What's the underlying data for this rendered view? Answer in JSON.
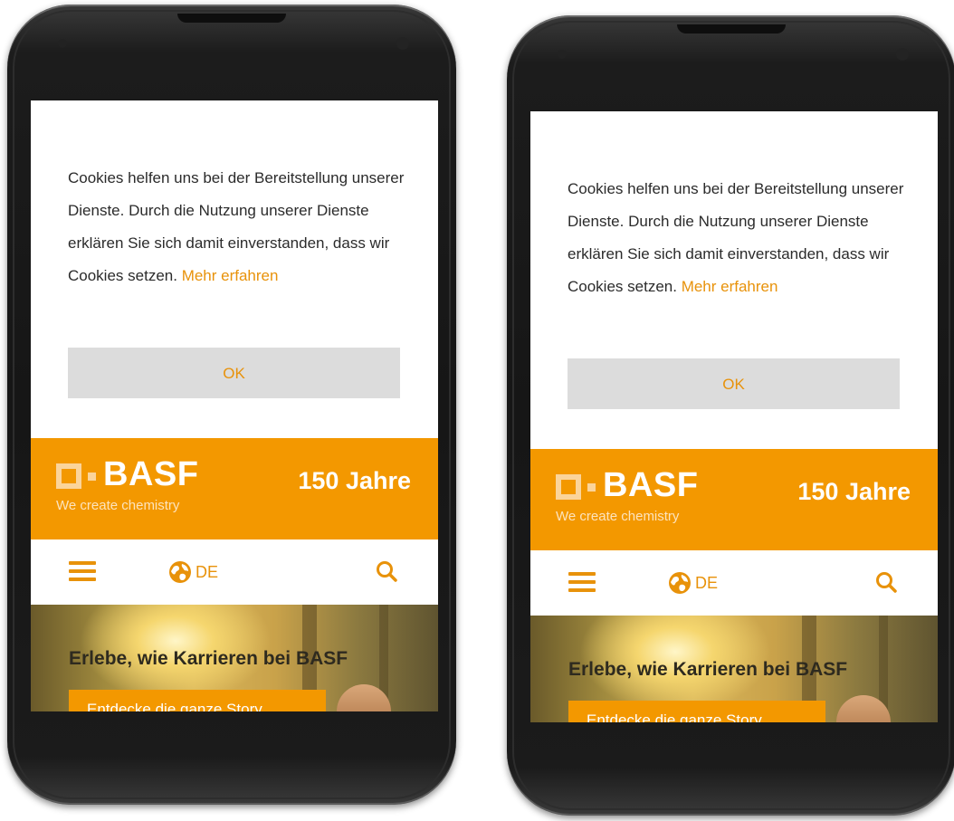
{
  "devices": [
    {
      "cookie": {
        "text": "Cookies helfen uns bei der Bereitstellung unserer Dienste. Durch die Nutzung unserer Dienste erklären Sie sich damit einverstanden, dass wir Cookies setzen.",
        "link": "Mehr erfahren",
        "ok": "OK"
      },
      "header": {
        "logo": "BASF",
        "tagline": "We create chemistry",
        "anniversary": "150 Jahre"
      },
      "nav": {
        "menu_icon": "hamburger-icon",
        "globe_icon": "globe-icon",
        "language": "DE",
        "search_icon": "search-icon"
      },
      "hero": {
        "title": "Erlebe, wie Karrieren bei BASF",
        "cta": "Entdecke die ganze Story"
      }
    },
    {
      "cookie": {
        "text": "Cookies helfen uns bei der Bereitstellung unserer Dienste. Durch die Nutzung unserer Dienste erklären Sie sich damit einverstanden, dass wir Cookies setzen.",
        "link": "Mehr erfahren",
        "ok": "OK"
      },
      "header": {
        "logo": "BASF",
        "tagline": "We create chemistry",
        "anniversary": "150 Jahre"
      },
      "nav": {
        "menu_icon": "hamburger-icon",
        "globe_icon": "globe-icon",
        "language": "DE",
        "search_icon": "search-icon"
      },
      "hero": {
        "title": "Erlebe, wie Karrieren bei BASF",
        "cta": "Entdecke die ganze Story"
      }
    }
  ],
  "colors": {
    "brand_orange": "#f39800",
    "link_orange": "#e8920a",
    "ok_button_bg": "#dcdcdc"
  }
}
